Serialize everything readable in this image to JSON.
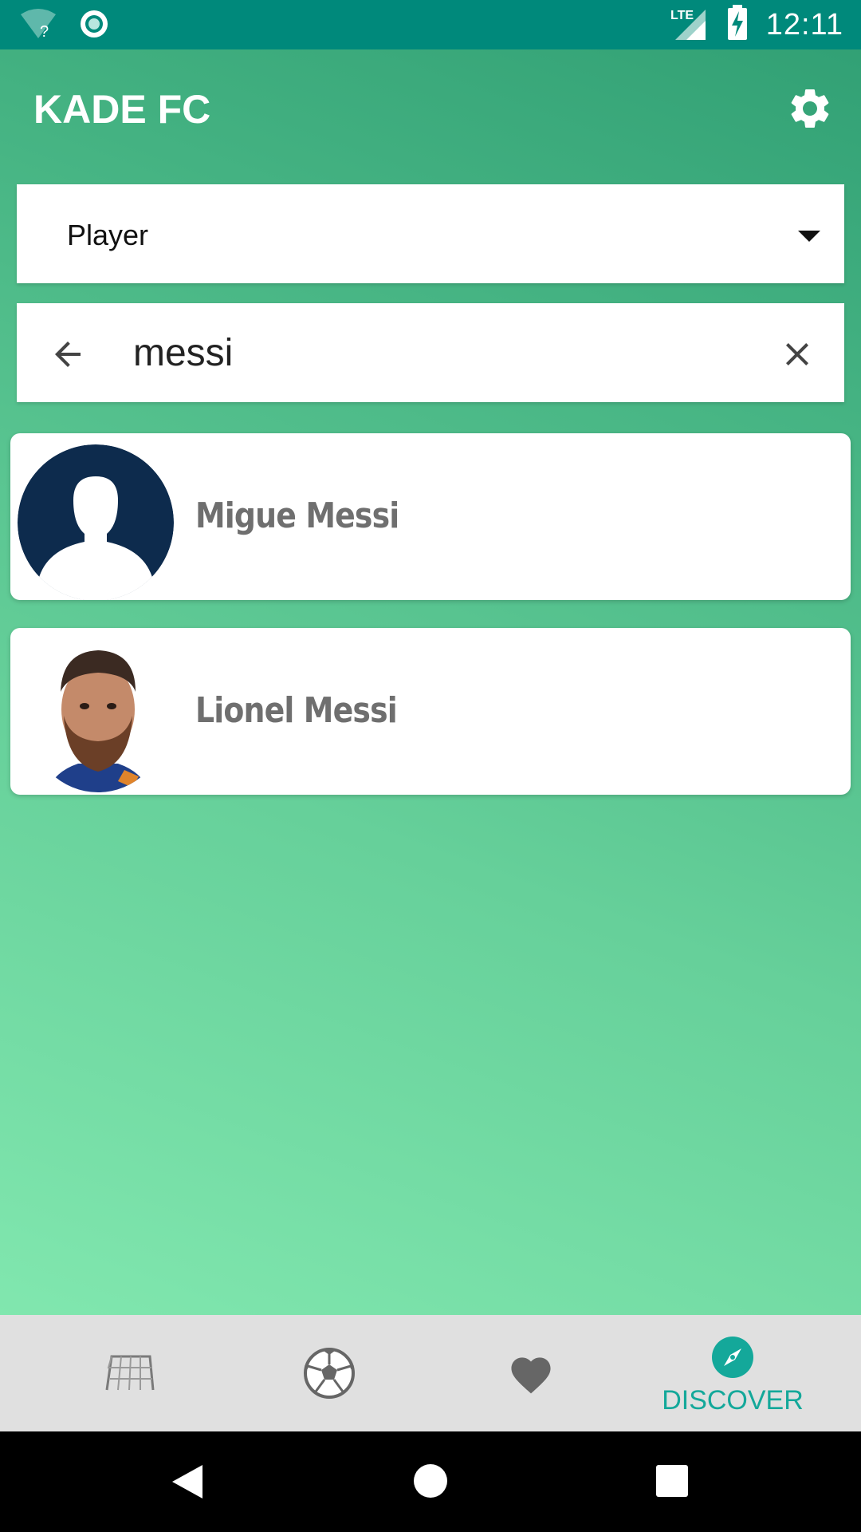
{
  "status_bar": {
    "time": "12:11",
    "network": "LTE",
    "wifi_badge": "?",
    "icons": [
      "wifi-unknown-icon",
      "sync-icon",
      "lte-signal-icon",
      "battery-charging-icon"
    ]
  },
  "app_bar": {
    "title": "KADE FC",
    "settings_icon": "gear-icon"
  },
  "dropdown": {
    "selected": "Player",
    "icon": "caret-down-icon"
  },
  "search": {
    "value": "messi",
    "back_icon": "arrow-back-icon",
    "clear_icon": "close-icon"
  },
  "results": [
    {
      "name": "Migue Messi",
      "avatar": "default-person-avatar"
    },
    {
      "name": "Lionel Messi",
      "avatar": "player-photo"
    }
  ],
  "bottom_nav": {
    "items": [
      {
        "icon": "goal-net-icon",
        "label": ""
      },
      {
        "icon": "soccer-ball-icon",
        "label": ""
      },
      {
        "icon": "heart-icon",
        "label": ""
      },
      {
        "icon": "compass-icon",
        "label": "DISCOVER",
        "active": true
      }
    ],
    "active_color": "#14a89a"
  },
  "colors": {
    "status_bar": "#00897b",
    "gradient_top": "#2f9e73",
    "gradient_bottom": "#8aefb6",
    "name_text": "#6f6f6f"
  }
}
